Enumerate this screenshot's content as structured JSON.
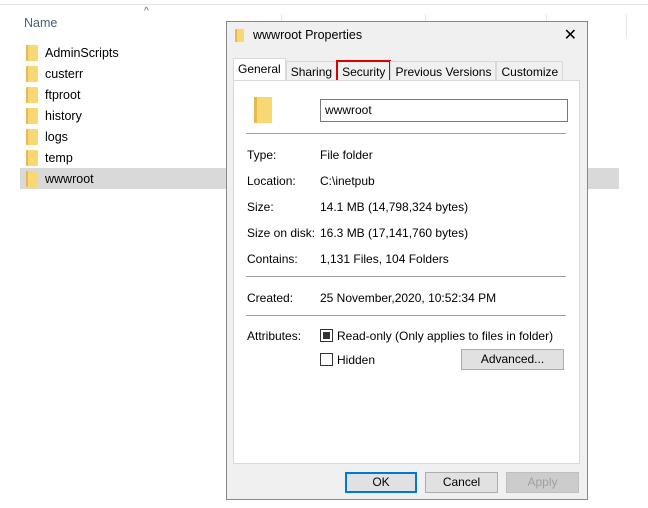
{
  "explorer": {
    "name_header": "Name",
    "items": [
      "AdminScripts",
      "custerr",
      "ftproot",
      "history",
      "logs",
      "temp",
      "wwwroot"
    ],
    "selected": "wwwroot"
  },
  "dialog": {
    "title": "wwwroot Properties",
    "tabs": [
      "General",
      "Sharing",
      "Security",
      "Previous Versions",
      "Customize"
    ],
    "active_tab": "General",
    "highlighted_tab": "Security",
    "name_value": "wwwroot",
    "props": [
      {
        "label": "Type:",
        "value": "File folder"
      },
      {
        "label": "Location:",
        "value": "C:\\inetpub"
      },
      {
        "label": "Size:",
        "value": "14.1 MB (14,798,324 bytes)"
      },
      {
        "label": "Size on disk:",
        "value": "16.3 MB (17,141,760 bytes)"
      },
      {
        "label": "Contains:",
        "value": "1,131 Files, 104 Folders"
      }
    ],
    "created": {
      "label": "Created:",
      "value": "25 November,2020, 10:52:34 PM"
    },
    "attributes_label": "Attributes:",
    "readonly": {
      "label": "Read-only (Only applies to files in folder)",
      "state": "indeterminate"
    },
    "hidden": {
      "label": "Hidden",
      "checked": false
    },
    "advanced": "Advanced...",
    "ok": "OK",
    "cancel": "Cancel",
    "apply": "Apply"
  },
  "colors": {
    "highlight": "#e00000",
    "default_button": "#0078d7"
  }
}
